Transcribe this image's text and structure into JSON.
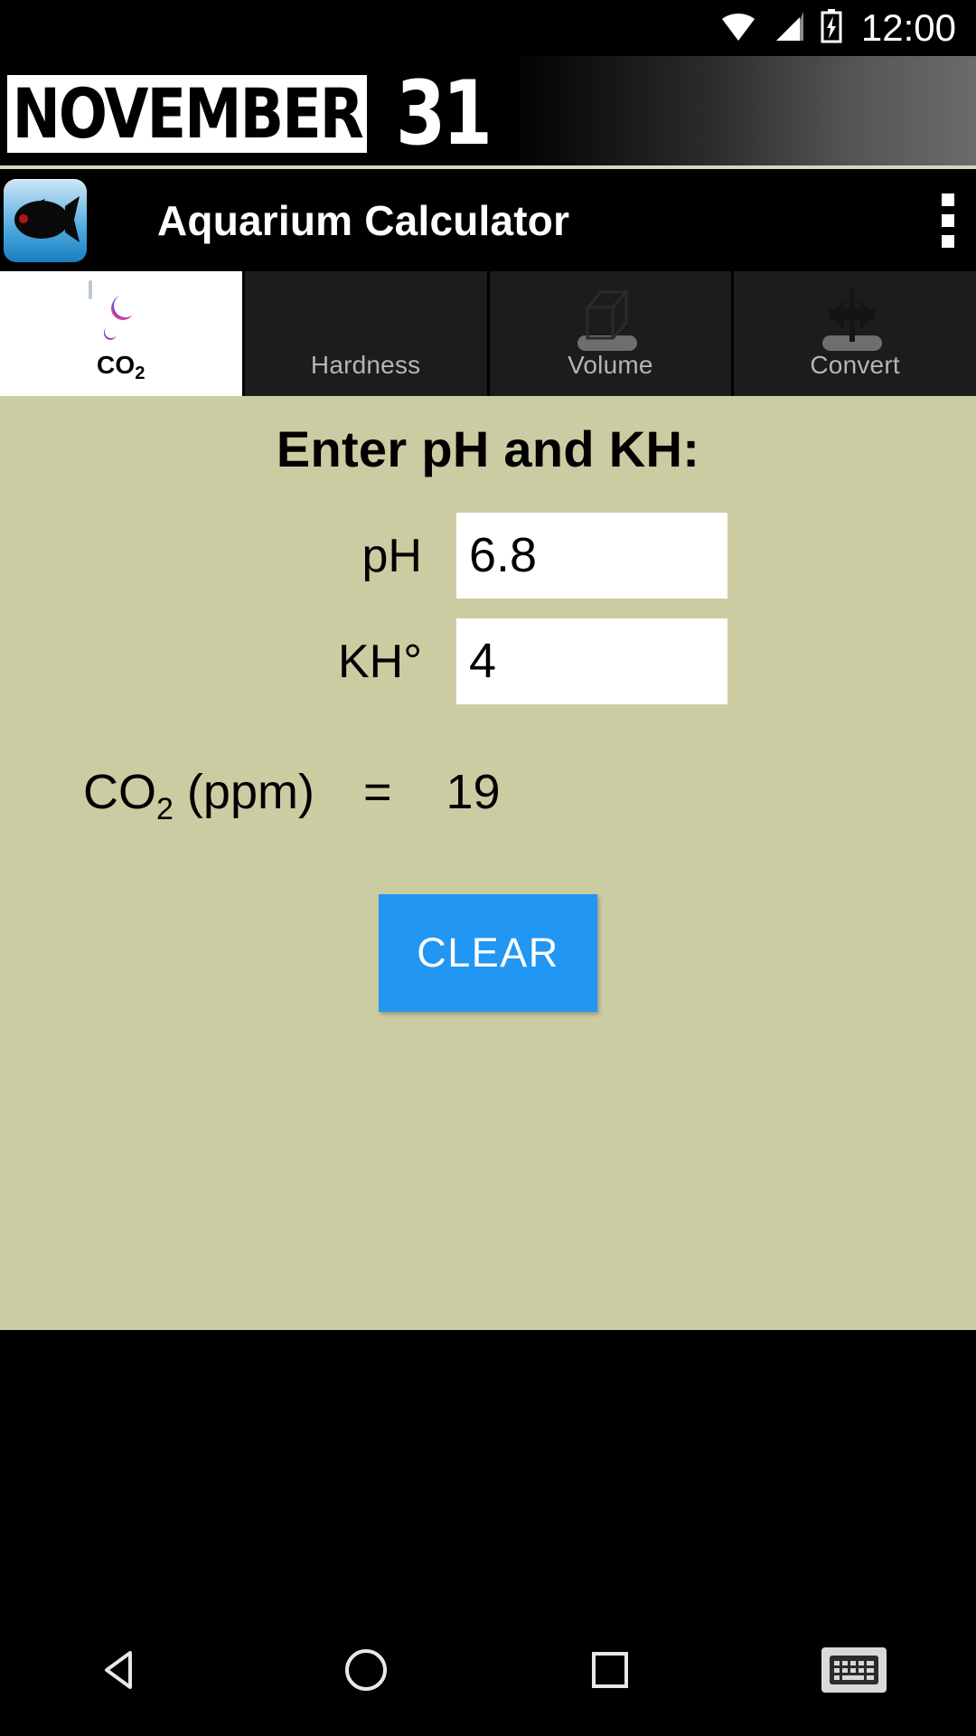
{
  "status_bar": {
    "clock": "12:00",
    "icons": [
      "wifi-icon",
      "cellular-signal-icon",
      "battery-charging-icon"
    ]
  },
  "banner": {
    "month": "NOVEMBER",
    "day": "31"
  },
  "app_bar": {
    "title": "Aquarium Calculator",
    "app_icon": "fish-icon",
    "overflow_icon": "overflow-menu-icon"
  },
  "tabs": [
    {
      "label": "CO",
      "sub": "2",
      "icon": "co2-bubbles-icon",
      "active": true
    },
    {
      "label": "Hardness",
      "sub": "",
      "icon": "hardness-block-icon",
      "active": false
    },
    {
      "label": "Volume",
      "sub": "",
      "icon": "cube-icon",
      "active": false
    },
    {
      "label": "Convert",
      "sub": "",
      "icon": "convert-arrows-icon",
      "active": false
    }
  ],
  "main": {
    "heading": "Enter pH and KH:",
    "fields": [
      {
        "label": "pH",
        "value": "6.8",
        "placeholder": ""
      },
      {
        "label": "KH°",
        "value": "4",
        "placeholder": ""
      }
    ],
    "result": {
      "label": "CO",
      "label_sub": "2",
      "label_rest": " (ppm)",
      "equals": "=",
      "value": "19"
    },
    "clear_label": "CLEAR"
  },
  "nav_bar": {
    "back": "back-triangle-icon",
    "home": "home-circle-icon",
    "recents": "recents-square-icon",
    "keyboard": "keyboard-icon"
  },
  "colors": {
    "content_background": "#ccccA3",
    "accent_button": "#2196f3",
    "tab_inactive_background": "#1c1c1c",
    "tab_active_background": "#ffffff",
    "system_chrome": "#000000"
  }
}
